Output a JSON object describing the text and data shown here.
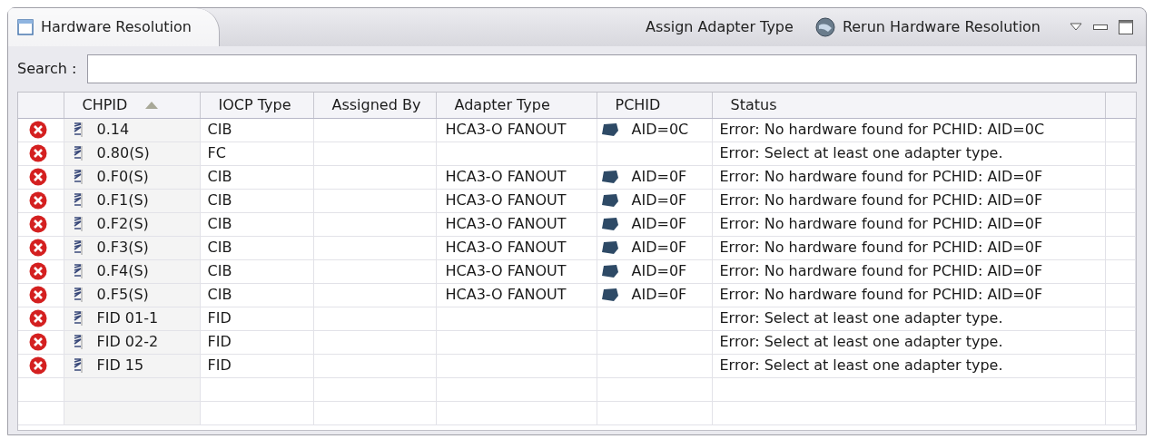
{
  "view": {
    "title": "Hardware Resolution",
    "actions": [
      {
        "label": "Assign Adapter Type",
        "kind": "text"
      },
      {
        "label": "Rerun Hardware Resolution",
        "kind": "icon"
      }
    ]
  },
  "search": {
    "label": "Search :"
  },
  "table": {
    "columns": [
      {
        "sorted": false
      },
      {
        "label": "CHPID",
        "sorted": true
      },
      {
        "label": "IOCP Type",
        "sorted": false
      },
      {
        "label": "Assigned By",
        "sorted": false
      },
      {
        "label": "Adapter Type",
        "sorted": false
      },
      {
        "label": "PCHID",
        "sorted": false
      },
      {
        "label": "Status",
        "sorted": false
      }
    ],
    "rows": [
      {
        "kind": "error",
        "chpid": "0.14",
        "iocp_type": "CIB",
        "adapter_type": "HCA3-O FANOUT",
        "pchid": "AID=0C",
        "status": "Error: No hardware found for PCHID: AID=0C"
      },
      {
        "kind": "error",
        "chpid": "0.80(S)",
        "iocp_type": "FC",
        "status": "Error: Select at least one adapter type."
      },
      {
        "kind": "error",
        "chpid": "0.F0(S)",
        "iocp_type": "CIB",
        "adapter_type": "HCA3-O FANOUT",
        "pchid": "AID=0F",
        "status": "Error: No hardware found for PCHID: AID=0F"
      },
      {
        "kind": "error",
        "chpid": "0.F1(S)",
        "iocp_type": "CIB",
        "adapter_type": "HCA3-O FANOUT",
        "pchid": "AID=0F",
        "status": "Error: No hardware found for PCHID: AID=0F"
      },
      {
        "kind": "error",
        "chpid": "0.F2(S)",
        "iocp_type": "CIB",
        "adapter_type": "HCA3-O FANOUT",
        "pchid": "AID=0F",
        "status": "Error: No hardware found for PCHID: AID=0F"
      },
      {
        "kind": "error",
        "chpid": "0.F3(S)",
        "iocp_type": "CIB",
        "adapter_type": "HCA3-O FANOUT",
        "pchid": "AID=0F",
        "status": "Error: No hardware found for PCHID: AID=0F"
      },
      {
        "kind": "error",
        "chpid": "0.F4(S)",
        "iocp_type": "CIB",
        "adapter_type": "HCA3-O FANOUT",
        "pchid": "AID=0F",
        "status": "Error: No hardware found for PCHID: AID=0F"
      },
      {
        "kind": "error",
        "chpid": "0.F5(S)",
        "iocp_type": "CIB",
        "adapter_type": "HCA3-O FANOUT",
        "pchid": "AID=0F",
        "status": "Error: No hardware found for PCHID: AID=0F"
      },
      {
        "kind": "error",
        "chpid": "FID 01-1",
        "iocp_type": "FID",
        "status": "Error: Select at least one adapter type."
      },
      {
        "kind": "error",
        "chpid": "FID 02-2",
        "iocp_type": "FID",
        "status": "Error: Select at least one adapter type."
      },
      {
        "kind": "error",
        "chpid": "FID 15",
        "iocp_type": "FID",
        "status": "Error: Select at least one adapter type."
      }
    ]
  }
}
